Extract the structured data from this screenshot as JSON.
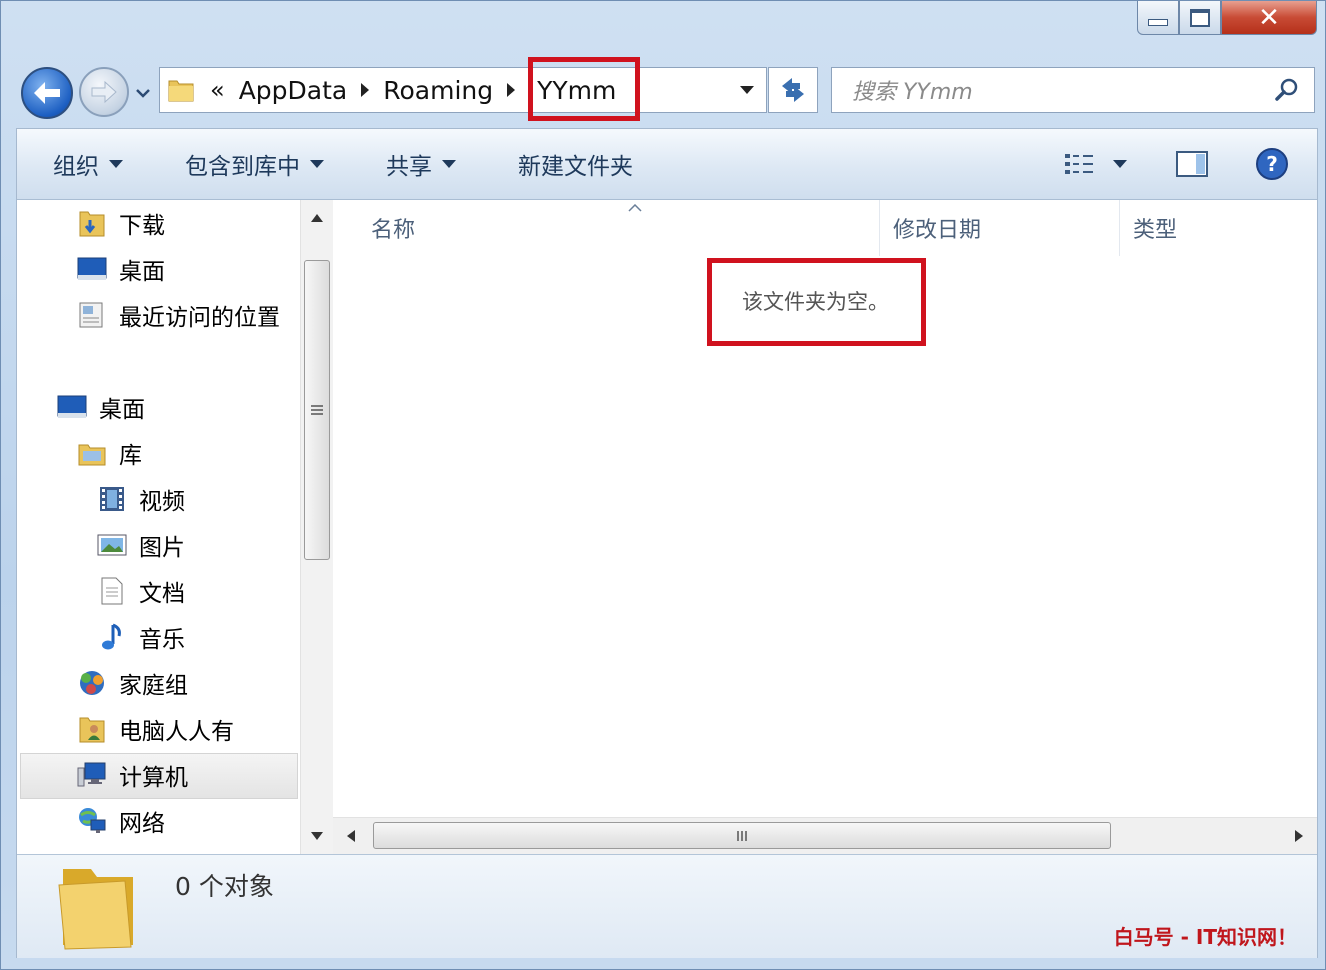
{
  "window": {
    "close_glyph": "✕"
  },
  "address": {
    "chevrons": "«",
    "crumbs": [
      "AppData",
      "Roaming",
      "YYmm"
    ]
  },
  "search": {
    "placeholder": "搜索 YYmm"
  },
  "toolbar": {
    "organize": "组织",
    "include_library": "包含到库中",
    "share": "共享",
    "new_folder": "新建文件夹"
  },
  "nav": {
    "favorites": [
      "下载",
      "桌面",
      "最近访问的位置"
    ],
    "desktop": "桌面",
    "libraries": "库",
    "library_items": [
      "视频",
      "图片",
      "文档",
      "音乐"
    ],
    "homegroup": "家庭组",
    "user": "电脑人人有",
    "computer": "计算机",
    "network": "网络"
  },
  "columns": {
    "name": "名称",
    "modified": "修改日期",
    "type": "类型"
  },
  "content": {
    "empty_message": "该文件夹为空。"
  },
  "details": {
    "object_count": "0 个对象"
  },
  "watermark": "白马号 - IT知识网！",
  "colors": {
    "highlight": "#d0121e",
    "toolbar_text": "#1e395b"
  }
}
